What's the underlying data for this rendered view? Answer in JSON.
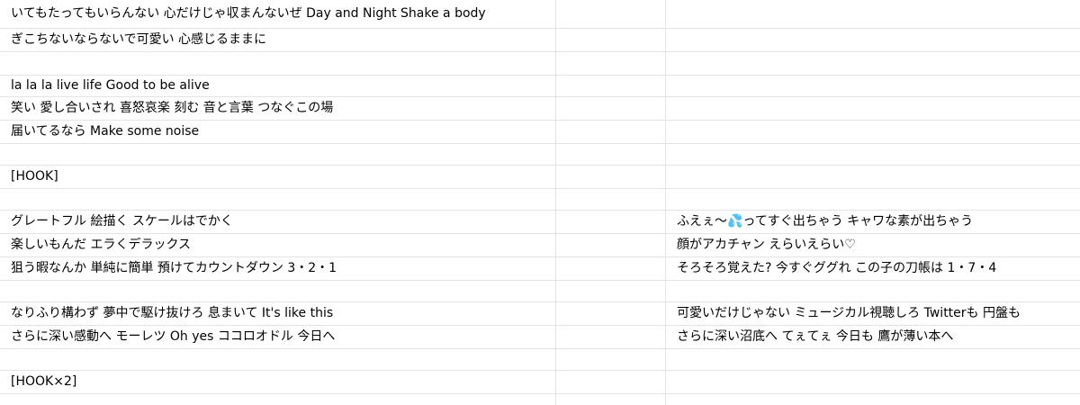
{
  "sheet": {
    "rows": [
      {
        "a": "いてもたってもいらんない  心だけじゃ収まんないぜ  Day and Night  Shake a body",
        "c": ""
      },
      {
        "a": "ぎこちないならないで可愛い 心感じるままに",
        "c": ""
      },
      {
        "a": "",
        "c": ""
      },
      {
        "a": "la la la live life  Good to be alive",
        "c": ""
      },
      {
        "a": "笑い  愛し合いされ  喜怒哀楽  刻む  音と言葉  つなぐこの場",
        "c": ""
      },
      {
        "a": "届いてるなら  Make some noise",
        "c": ""
      },
      {
        "a": "",
        "c": ""
      },
      {
        "a": "[HOOK]",
        "c": ""
      },
      {
        "a": "",
        "c": ""
      },
      {
        "a": "グレートフル  絵描く  スケールはでかく",
        "c": "ふえぇ〜💦ってすぐ出ちゃう キャワな素が出ちゃう"
      },
      {
        "a": "楽しいもんだ  エラくデラックス",
        "c": "顔がアカチャン えらいえらい♡"
      },
      {
        "a": "狙う暇なんか  単純に簡単  預けてカウントダウン  3・2・1",
        "c": "そろそろ覚えた? 今すぐググれ この子の刀帳は 1・7・4"
      },
      {
        "a": "",
        "c": ""
      },
      {
        "a": "なりふり構わず  夢中で駆け抜けろ  息まいて  It's like this",
        "c": "可愛いだけじゃない ミュージカル視聴しろ Twitterも 円盤も"
      },
      {
        "a": "さらに深い感動へ  モーレツ  Oh yes  ココロオドル  今日へ",
        "c": "さらに深い沼底へ てぇてぇ 今日も 鷹が薄い本へ"
      },
      {
        "a": "",
        "c": ""
      },
      {
        "a": "[HOOK×2]",
        "c": ""
      },
      {
        "a": "",
        "c": ""
      }
    ]
  }
}
